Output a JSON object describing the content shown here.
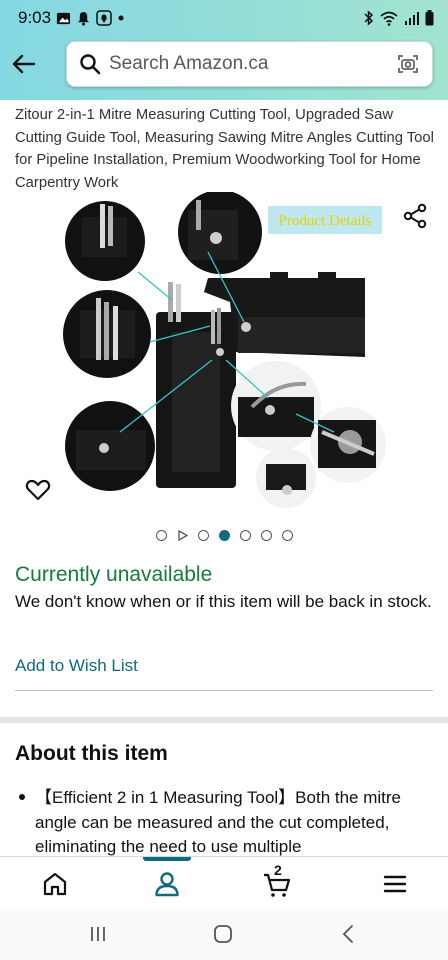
{
  "status_bar": {
    "time": "9:03",
    "left_icons": [
      "image-icon",
      "notification-bell-icon",
      "location-icon",
      "dot-icon"
    ],
    "right_icons": [
      "bluetooth-icon",
      "wifi-icon",
      "signal-icon",
      "battery-icon"
    ]
  },
  "search": {
    "placeholder": "Search Amazon.ca"
  },
  "product": {
    "title": "Zitour 2-in-1 Mitre Measuring Cutting Tool, Upgraded Saw Cutting Guide Tool, Measuring Sawing Mitre Angles Cutting Tool for Pipeline Installation, Premium Woodworking Tool for Home Carpentry Work",
    "image_overlay_text": "Product Details",
    "image_dots": [
      "dot",
      "play",
      "dot",
      "active",
      "dot",
      "dot",
      "dot"
    ],
    "availability_status": "Currently unavailable",
    "availability_message": "We don't know when or if this item will be back in stock.",
    "wishlist_label": "Add to Wish List"
  },
  "about": {
    "heading": "About this item",
    "bullets": [
      "【Efficient 2 in 1 Measuring Tool】Both the mitre angle can be measured and the cut completed, eliminating the need to use multiple"
    ]
  },
  "bottom_nav": {
    "items": [
      "home-icon",
      "account-icon",
      "cart-icon",
      "menu-icon"
    ],
    "active": "account-icon",
    "cart_count": "2"
  },
  "colors": {
    "header_gradient_start": "#84d8e3",
    "header_gradient_end": "#a2e3cf",
    "availability_green": "#157a3e",
    "link_teal": "#0f6a7e"
  }
}
